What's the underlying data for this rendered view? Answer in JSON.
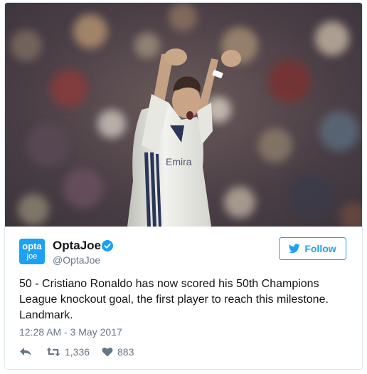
{
  "tweet": {
    "avatar": {
      "line1": "opta",
      "line2": "joe"
    },
    "author_name": "OptaJoe",
    "author_handle": "@OptaJoe",
    "follow_label": "Follow",
    "text_lines": [
      "50 - Cristiano Ronaldo has now scored his 50th Champions",
      "League knockout goal, the first player to reach this milestone.",
      "Landmark."
    ],
    "timestamp": "12:28 AM - 3 May 2017",
    "retweet_count": "1,336",
    "like_count": "883"
  },
  "photo": {
    "description_icon": "celebrating-player-photo",
    "jersey_text": "Emira"
  },
  "icons": {
    "verified": "verified-badge-icon",
    "follow": "twitter-bird-icon",
    "reply": "reply-icon",
    "retweet": "retweet-icon",
    "like": "heart-icon"
  },
  "colors": {
    "accent": "#1da1f2",
    "text": "#14171a",
    "muted": "#657786",
    "border": "#e1e8ed"
  }
}
